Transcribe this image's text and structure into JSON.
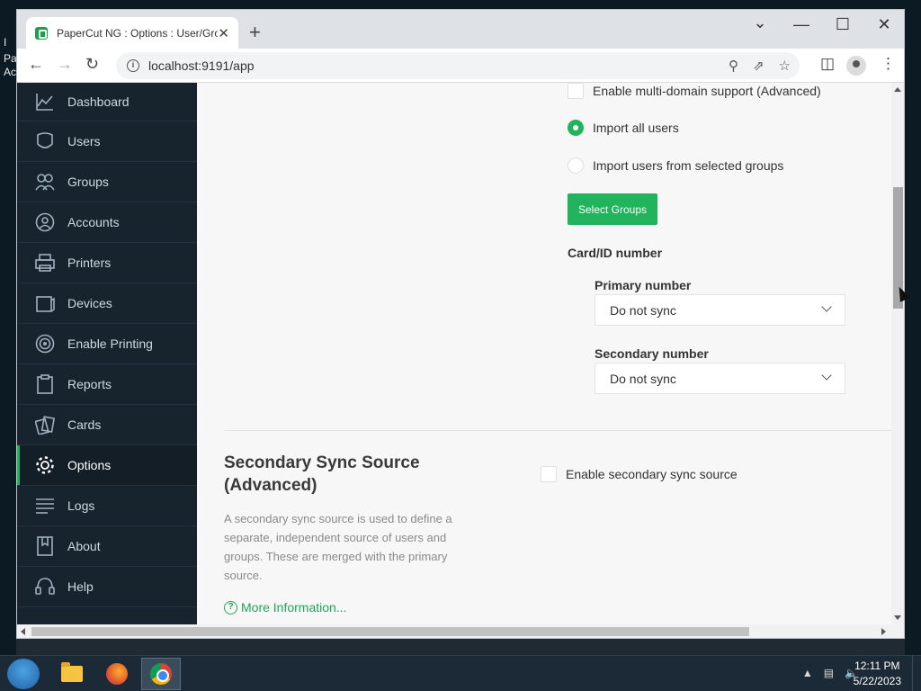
{
  "desktop": {
    "left_glyphs": [
      "I",
      "Pa",
      "Ac"
    ]
  },
  "browser": {
    "tab_title": "PaperCut NG : Options : User/Gro",
    "tab_close": "✕",
    "new_tab": "+",
    "url": "localhost:9191/app",
    "window_controls": {
      "dropdown": "⌄",
      "minimize": "—",
      "maximize": "☐",
      "close": "✕"
    }
  },
  "sidebar": {
    "items": [
      {
        "label": "Dashboard",
        "icon": "chart-line-icon"
      },
      {
        "label": "Users",
        "icon": "user-icon"
      },
      {
        "label": "Groups",
        "icon": "group-icon"
      },
      {
        "label": "Accounts",
        "icon": "account-icon"
      },
      {
        "label": "Printers",
        "icon": "printer-icon"
      },
      {
        "label": "Devices",
        "icon": "device-icon"
      },
      {
        "label": "Enable Printing",
        "icon": "enable-printing-icon"
      },
      {
        "label": "Reports",
        "icon": "report-icon"
      },
      {
        "label": "Cards",
        "icon": "cards-icon"
      },
      {
        "label": "Options",
        "icon": "gear-icon",
        "active": true
      },
      {
        "label": "Logs",
        "icon": "logs-icon"
      },
      {
        "label": "About",
        "icon": "about-icon"
      },
      {
        "label": "Help",
        "icon": "help-icon"
      }
    ]
  },
  "main": {
    "multi_domain_label": "Enable multi-domain support (Advanced)",
    "import_all_label": "Import all users",
    "import_selected_label": "Import users from selected groups",
    "import_choice": "Import all users",
    "select_groups_button": "Select Groups",
    "card_id_label": "Card/ID number",
    "primary_label": "Primary number",
    "primary_value": "Do not sync",
    "secondary_label": "Secondary number",
    "secondary_value": "Do not sync",
    "secondary_sync_title": "Secondary Sync Source (Advanced)",
    "secondary_sync_desc": "A secondary sync source is used to define a separate, independent source of users and groups. These are merged with the primary source.",
    "secondary_enable_label": "Enable secondary sync source",
    "more_info_link": "More Information..."
  },
  "taskbar": {
    "time": "12:11 PM",
    "date": "5/22/2023"
  },
  "colors": {
    "accent": "#21b45c",
    "sidebar_bg": "#17242e",
    "content_bg": "#f7f7f7"
  }
}
